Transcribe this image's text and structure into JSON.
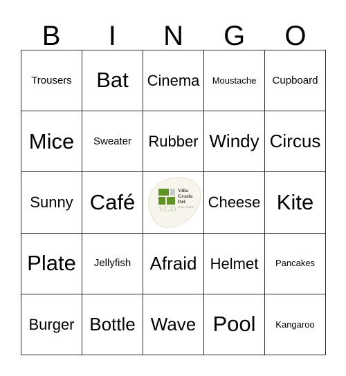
{
  "card": {
    "title": "BINGO",
    "header_letters": [
      "B",
      "I",
      "N",
      "G",
      "O"
    ],
    "columns": 5,
    "rows": 5,
    "border_color": "#2b2b2b",
    "background_color": "#ffffff",
    "text_color": "#000000"
  },
  "grid": {
    "rows": [
      [
        {
          "label": "Trousers",
          "size": "s",
          "free": false
        },
        {
          "label": "Bat",
          "size": "xxl",
          "free": false
        },
        {
          "label": "Cinema",
          "size": "l",
          "free": false
        },
        {
          "label": "Moustache",
          "size": "xs",
          "free": false
        },
        {
          "label": "Cupboard",
          "size": "s",
          "free": false
        }
      ],
      [
        {
          "label": "Mice",
          "size": "xxl",
          "free": false
        },
        {
          "label": "Sweater",
          "size": "s",
          "free": false
        },
        {
          "label": "Rubber",
          "size": "l",
          "free": false
        },
        {
          "label": "Windy",
          "size": "xl",
          "free": false
        },
        {
          "label": "Circus",
          "size": "xl",
          "free": false
        }
      ],
      [
        {
          "label": "Sunny",
          "size": "l",
          "free": false
        },
        {
          "label": "Café",
          "size": "xxl",
          "free": false
        },
        {
          "label": "",
          "size": "m",
          "free": true
        },
        {
          "label": "Cheese",
          "size": "l",
          "free": false
        },
        {
          "label": "Kite",
          "size": "xxl",
          "free": false
        }
      ],
      [
        {
          "label": "Plate",
          "size": "xxl",
          "free": false
        },
        {
          "label": "Jellyfish",
          "size": "s",
          "free": false
        },
        {
          "label": "Afraid",
          "size": "xl",
          "free": false
        },
        {
          "label": "Helmet",
          "size": "l",
          "free": false
        },
        {
          "label": "Pancakes",
          "size": "xs",
          "free": false
        }
      ],
      [
        {
          "label": "Burger",
          "size": "l",
          "free": false
        },
        {
          "label": "Bottle",
          "size": "xl",
          "free": false
        },
        {
          "label": "Wave",
          "size": "xl",
          "free": false
        },
        {
          "label": "Pool",
          "size": "xxl",
          "free": false
        },
        {
          "label": "Kangaroo",
          "size": "xs",
          "free": false
        }
      ]
    ]
  },
  "free_space": {
    "type": "logo",
    "logo_name": "villa-gratia-dei-college-logo",
    "line1": "Villa",
    "line2": "Gratia",
    "line3": "Dei",
    "line4": "COLLEGE",
    "monogram": "VGD",
    "colors": {
      "green": "#5f9125",
      "gray_block": "#c9c9c9",
      "blob": "#f7f5ea",
      "blob_stroke": "#e4e0cd",
      "text": "#3a3a3a",
      "college_text": "#9a9a8e"
    }
  }
}
